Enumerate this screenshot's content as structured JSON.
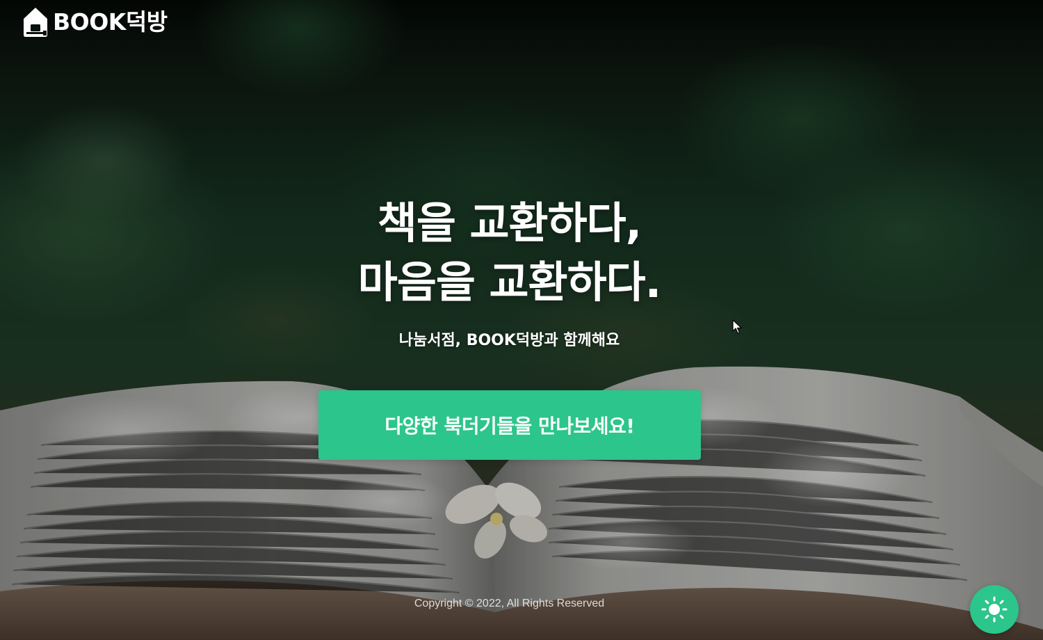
{
  "header": {
    "logo_text": "BOOK덕방",
    "logo_icon": "house-book-icon"
  },
  "hero": {
    "title_line1": "책을 교환하다,",
    "title_line2": "마음을 교환하다.",
    "subtitle": "나눔서점, BOOK덕방과 함께해요",
    "cta_label": "다양한 북더기들을 만나보세요!"
  },
  "footer": {
    "copyright": "Copyright © 2022, All Rights Reserved"
  },
  "theme_toggle": {
    "icon": "sun-icon"
  },
  "colors": {
    "accent": "#2cc58b",
    "text": "#ffffff"
  }
}
